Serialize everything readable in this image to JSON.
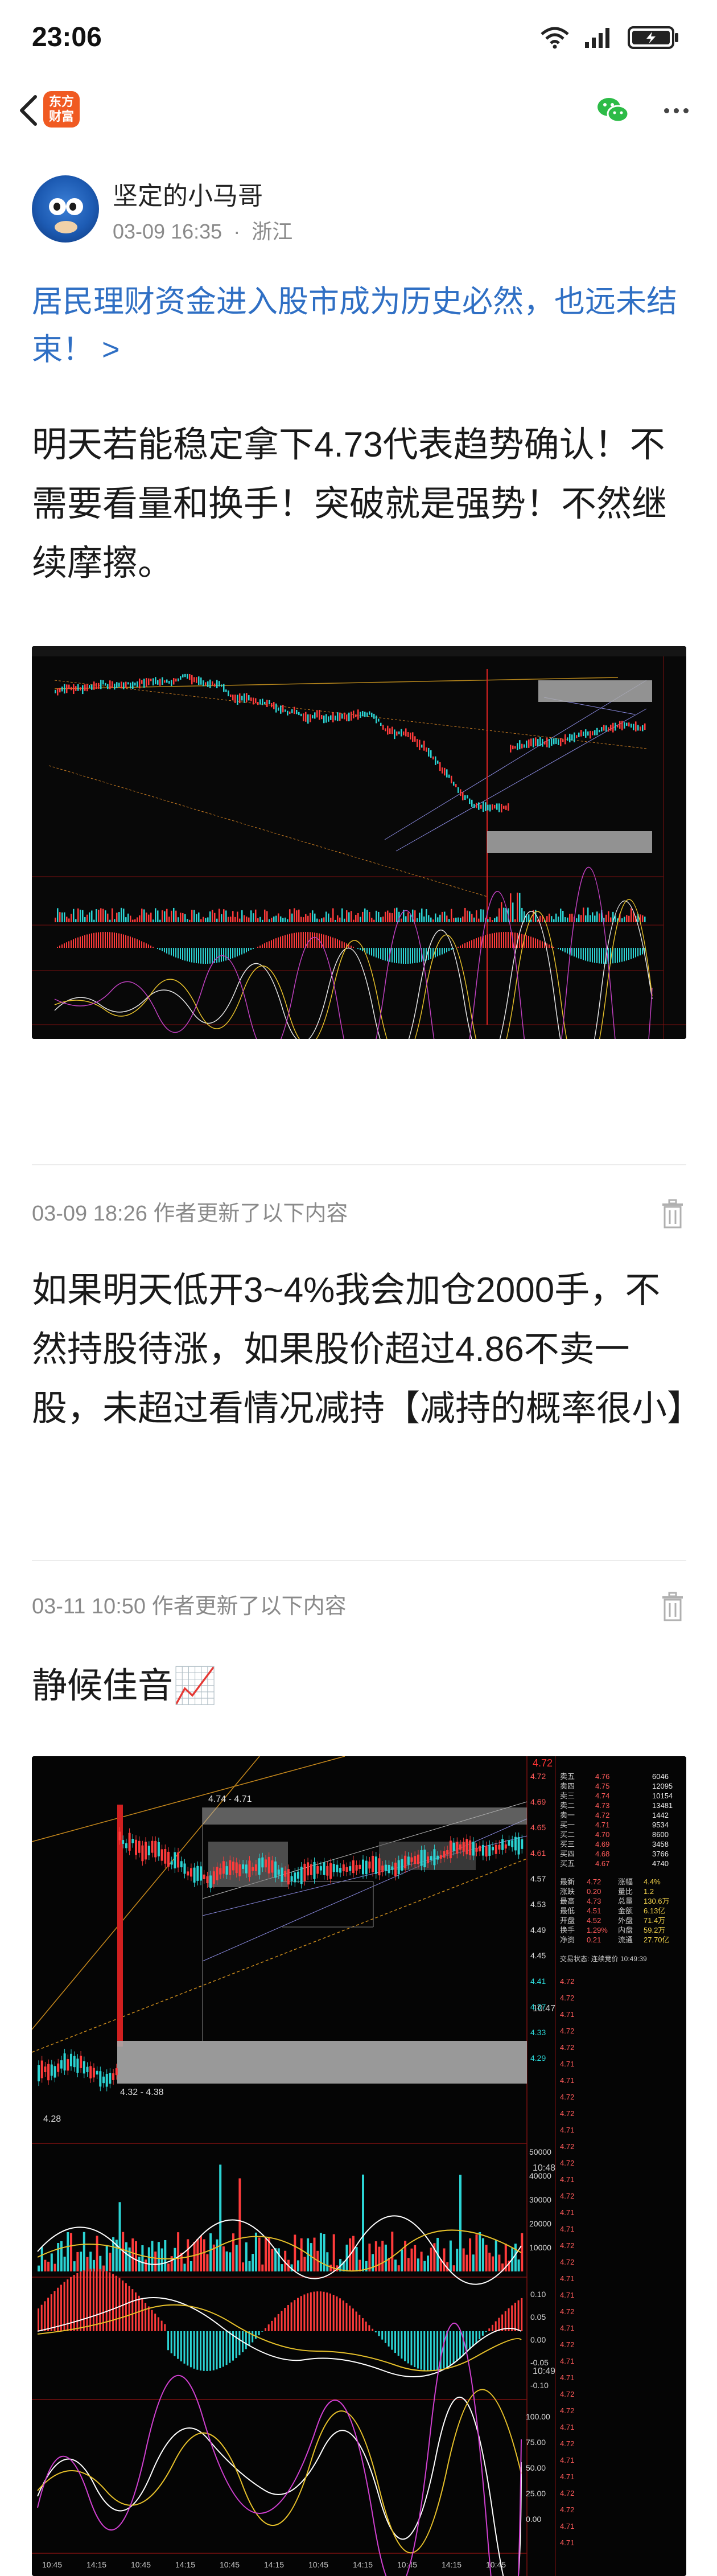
{
  "status": {
    "time": "23:06",
    "battery": "100"
  },
  "nav": {
    "logo_line1": "东方",
    "logo_line2": "财富"
  },
  "author": {
    "name": "坚定的小马哥",
    "date": "03-09 16:35",
    "location": "浙江"
  },
  "post": {
    "title": "居民理财资金进入股市成为历史必然，也远未结束！ >",
    "body": "明天若能稳定拿下4.73代表趋势确认！不需要看量和换手！突破就是强势！不然继续摩擦。"
  },
  "updates": [
    {
      "header": "03-09 18:26  作者更新了以下内容",
      "text": "如果明天低开3~4%我会加仓2000手，不然持股待涨，如果股价超过4.86不卖一股，未超过看情况减持【减持的概率很小】"
    },
    {
      "header": "03-11 10:50  作者更新了以下内容",
      "text": "静候佳音📈"
    }
  ],
  "chart2_labels": {
    "price_top": "4.72",
    "range1": "4.74 - 4.71",
    "range2": "4.32 - 4.38",
    "low": "4.28",
    "time1": "10:47",
    "time2": "10:48",
    "time3": "10:49",
    "y_axis": [
      "4.72",
      "4.69",
      "4.65",
      "4.61",
      "4.57",
      "4.53",
      "4.49",
      "4.45",
      "4.41",
      "4.37",
      "4.33",
      "4.29"
    ],
    "vol_axis": [
      "50000",
      "40000",
      "30000",
      "20000",
      "10000"
    ],
    "macd_axis": [
      "0.10",
      "0.05",
      "0.00",
      "-0.05",
      "-0.10"
    ],
    "kdj_axis": [
      "100.00",
      "75.00",
      "50.00",
      "25.00",
      "0.00"
    ],
    "x_axis": [
      "10:45",
      "14:15",
      "10:45",
      "14:15",
      "10:45",
      "14:15",
      "10:45",
      "14:15",
      "10:45",
      "14:15",
      "10:45"
    ],
    "book_labels": [
      "卖五",
      "卖四",
      "卖三",
      "卖二",
      "卖一",
      "买一",
      "买二",
      "买三",
      "买四",
      "买五"
    ],
    "book_prices": [
      "4.76",
      "4.75",
      "4.74",
      "4.73",
      "4.72",
      "4.71",
      "4.70",
      "4.69",
      "4.68",
      "4.67"
    ],
    "book_vols": [
      "6046",
      "12095",
      "10154",
      "13481",
      "1442",
      "9534",
      "8600",
      "3458",
      "3766",
      "4740"
    ],
    "stats": [
      [
        "最新",
        "4.72",
        "涨幅",
        "4.4%"
      ],
      [
        "涨跌",
        "0.20",
        "量比",
        "1.2"
      ],
      [
        "最高",
        "4.73",
        "总量",
        "130.6万"
      ],
      [
        "最低",
        "4.51",
        "金额",
        "6.13亿"
      ],
      [
        "开盘",
        "4.52",
        "外盘",
        "71.4万"
      ],
      [
        "换手",
        "1.29%",
        "内盘",
        "59.2万"
      ],
      [
        "净资",
        "0.21",
        "流通",
        "27.70亿"
      ]
    ],
    "stats_footer": "交易状态: 连续竞价 10:49:39",
    "ticks": [
      "4.72",
      "4.72",
      "4.71",
      "4.72",
      "4.72",
      "4.71",
      "4.71",
      "4.72",
      "4.72",
      "4.71",
      "4.72",
      "4.72",
      "4.71",
      "4.72",
      "4.71",
      "4.71",
      "4.72",
      "4.72",
      "4.71",
      "4.71",
      "4.72",
      "4.71",
      "4.72",
      "4.71",
      "4.71",
      "4.72",
      "4.72",
      "4.71",
      "4.72",
      "4.71",
      "4.71",
      "4.72",
      "4.72",
      "4.71",
      "4.71"
    ]
  }
}
